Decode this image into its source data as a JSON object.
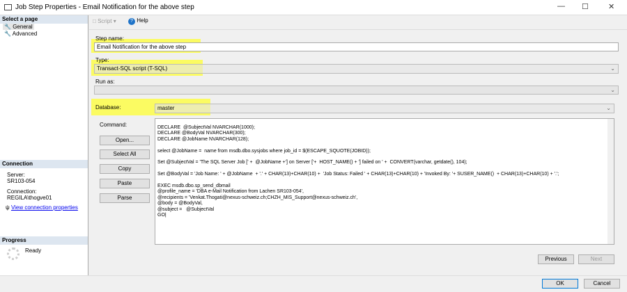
{
  "window": {
    "title": "Job Step Properties - Email Notification for the above step",
    "icon": "window-icon"
  },
  "left": {
    "select_page": "Select a page",
    "pages": [
      {
        "label": "General",
        "icon": "wrench-icon"
      },
      {
        "label": "Advanced",
        "icon": "wrench-icon"
      }
    ],
    "connection_header": "Connection",
    "server_label": "Server:",
    "server_value": "SR103-054",
    "connection_label": "Connection:",
    "connection_value": "REGILA\\thogve01",
    "view_connection": "View connection properties",
    "progress_header": "Progress",
    "progress_status": "Ready"
  },
  "toolbar": {
    "script": "Script",
    "help": "Help"
  },
  "form": {
    "step_name_label": "Step name:",
    "step_name_value": "Email Notification for the above step",
    "type_label": "Type:",
    "type_value": "Transact-SQL script (T-SQL)",
    "run_as_label": "Run as:",
    "run_as_value": "",
    "database_label": "Database:",
    "database_value": "master",
    "command_label": "Command:",
    "buttons": {
      "open": "Open...",
      "select_all": "Select All",
      "copy": "Copy",
      "paste": "Paste",
      "parse": "Parse"
    },
    "command": "DECLARE  @SubjectVal NVARCHAR(1000);\nDECLARE @BodyVal NVARCHAR(300);\nDECLARE @JobName NVARCHAR(128);\n\nselect @JobName =  name from msdb.dbo.sysjobs where job_id = $(ESCAPE_SQUOTE(JOBID));\n\nSet @SubjectVal = 'The SQL Server Job [' +  @JobName +'] on Server ['+  HOST_NAME() + '] failed on ' +  CONVERT(varchar, getdate(), 104);\n\nSet @BodyVal = 'Job Name: ' + @JobName  + '.' + CHAR(13)+CHAR(10) +  'Job Status: Failed ' + CHAR(13)+CHAR(10) + 'Invoked By: '+ SUSER_NAME()  + CHAR(13)+CHAR(10) + '.';\n\nEXEC msdb.dbo.sp_send_dbmail\n@profile_name = 'DBA e-Mail Notification from Lachen SR103-054',\n@recipients = 'Venkat.Thogati@nexus-schweiz.ch;CHZH_MIS_Support@nexus-schweiz.ch',\n@body = @BodyVal,\n@subject =   @SubjectVal\nGO|",
    "previous": "Previous",
    "next": "Next"
  },
  "footer": {
    "ok": "OK",
    "cancel": "Cancel"
  }
}
